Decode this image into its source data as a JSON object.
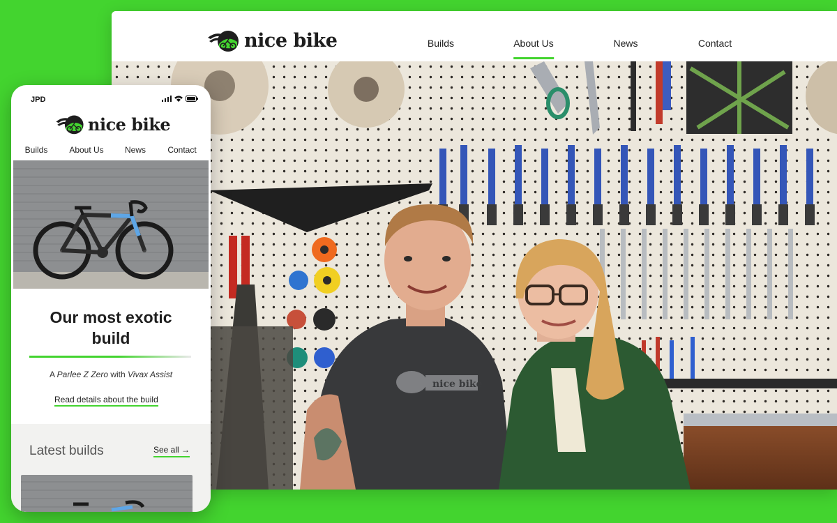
{
  "brand": {
    "name": "nice bike"
  },
  "desktop": {
    "nav": [
      {
        "label": "Builds",
        "active": false
      },
      {
        "label": "About Us",
        "active": true
      },
      {
        "label": "News",
        "active": false
      },
      {
        "label": "Contact",
        "active": false
      }
    ],
    "shirt_text": "nice bike"
  },
  "phone": {
    "carrier": "JPD",
    "nav": [
      "Builds",
      "About Us",
      "News",
      "Contact"
    ],
    "feature_title_line1": "Our most exotic",
    "feature_title_line2": "build",
    "feature_sub_prefix": "A ",
    "feature_sub_name": "Parlee Z Zero",
    "feature_sub_mid": " with ",
    "feature_sub_assist": "Vivax Assist",
    "feature_link": "Read details about the build",
    "latest_title": "Latest builds",
    "see_all": "See all"
  },
  "colors": {
    "accent": "#43d42f",
    "text": "#1e1e1e",
    "panel": "#f2f2f0"
  }
}
